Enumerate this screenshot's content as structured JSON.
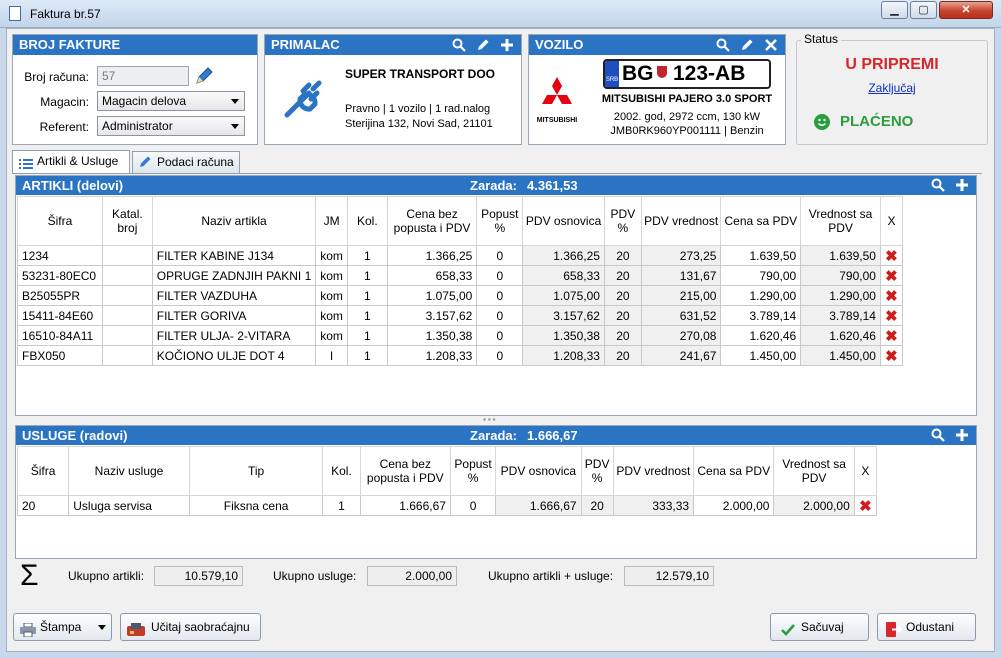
{
  "window": {
    "title": "Faktura br.57"
  },
  "broj_fakture": {
    "header": "BROJ FAKTURE",
    "broj_label": "Broj računa:",
    "broj_value": "57",
    "magacin_label": "Magacin:",
    "magacin_value": "Magacin delova",
    "referent_label": "Referent:",
    "referent_value": "Administrator"
  },
  "primalac": {
    "header": "PRIMALAC",
    "name": "SUPER TRANSPORT DOO",
    "info": "Pravno | 1 vozilo | 1 rad.nalog",
    "address": "Sterijina 132, Novi Sad, 21101"
  },
  "vozilo": {
    "header": "VOZILO",
    "plate_country": "SRB",
    "plate_city": "BG",
    "plate_number": "123-AB",
    "brand_label": "MITSUBISHI",
    "model": "MITSUBISHI PAJERO 3.0 SPORT",
    "specs": "2002. god, 2972 ccm, 130 kW",
    "vin": "JMB0RK960YP001111 | Benzin"
  },
  "status": {
    "label": "Status",
    "state": "U PRIPREMI",
    "lock_link": "Zaključaj",
    "paid": "PLAĆENO"
  },
  "tabs": [
    {
      "label": "Artikli & Usluge"
    },
    {
      "label": "Podaci računa"
    }
  ],
  "artikli": {
    "header": "ARTIKLI (delovi)",
    "zarada_label": "Zarada:",
    "zarada_value": "4.361,53",
    "columns": [
      "Šifra",
      "Katal. broj",
      "Naziv artikla",
      "JM",
      "Kol.",
      "Cena bez popusta i PDV",
      "Popust %",
      "PDV osnovica",
      "PDV %",
      "PDV vrednost",
      "Cena sa PDV",
      "Vrednost sa PDV",
      "X"
    ],
    "rows": [
      {
        "sifra": "1234",
        "katal": "",
        "naziv": "FILTER KABINE J134",
        "jm": "kom",
        "kol": "1",
        "cena": "1.366,25",
        "popust": "0",
        "osnovica": "1.366,25",
        "pdv": "20",
        "pdv_vr": "273,25",
        "cena_pdv": "1.639,50",
        "vrednost": "1.639,50"
      },
      {
        "sifra": "53231-80EC0",
        "katal": "",
        "naziv": "OPRUGE ZADNJIH PAKNI 1",
        "jm": "kom",
        "kol": "1",
        "cena": "658,33",
        "popust": "0",
        "osnovica": "658,33",
        "pdv": "20",
        "pdv_vr": "131,67",
        "cena_pdv": "790,00",
        "vrednost": "790,00"
      },
      {
        "sifra": "B25055PR",
        "katal": "",
        "naziv": "FILTER  VAZDUHA",
        "jm": "kom",
        "kol": "1",
        "cena": "1.075,00",
        "popust": "0",
        "osnovica": "1.075,00",
        "pdv": "20",
        "pdv_vr": "215,00",
        "cena_pdv": "1.290,00",
        "vrednost": "1.290,00"
      },
      {
        "sifra": "15411-84E60",
        "katal": "",
        "naziv": "FILTER GORIVA",
        "jm": "kom",
        "kol": "1",
        "cena": "3.157,62",
        "popust": "0",
        "osnovica": "3.157,62",
        "pdv": "20",
        "pdv_vr": "631,52",
        "cena_pdv": "3.789,14",
        "vrednost": "3.789,14"
      },
      {
        "sifra": "16510-84A11",
        "katal": "",
        "naziv": "FILTER ULJA- 2-VITARA",
        "jm": "kom",
        "kol": "1",
        "cena": "1.350,38",
        "popust": "0",
        "osnovica": "1.350,38",
        "pdv": "20",
        "pdv_vr": "270,08",
        "cena_pdv": "1.620,46",
        "vrednost": "1.620,46"
      },
      {
        "sifra": "FBX050",
        "katal": "",
        "naziv": "KOČIONO ULJE DOT 4",
        "jm": "l",
        "kol": "1",
        "cena": "1.208,33",
        "popust": "0",
        "osnovica": "1.208,33",
        "pdv": "20",
        "pdv_vr": "241,67",
        "cena_pdv": "1.450,00",
        "vrednost": "1.450,00"
      }
    ]
  },
  "usluge": {
    "header": "USLUGE (radovi)",
    "zarada_label": "Zarada:",
    "zarada_value": "1.666,67",
    "columns": [
      "Šifra",
      "Naziv usluge",
      "Tip",
      "Kol.",
      "Cena bez popusta i PDV",
      "Popust %",
      "PDV osnovica",
      "PDV %",
      "PDV vrednost",
      "Cena sa PDV",
      "Vrednost sa PDV",
      "X"
    ],
    "rows": [
      {
        "sifra": "20",
        "naziv": "Usluga servisa",
        "tip": "Fiksna cena",
        "kol": "1",
        "cena": "1.666,67",
        "popust": "0",
        "osnovica": "1.666,67",
        "pdv": "20",
        "pdv_vr": "333,33",
        "cena_pdv": "2.000,00",
        "vrednost": "2.000,00"
      }
    ]
  },
  "totals": {
    "sigma": "Σ",
    "artikli_label": "Ukupno artikli:",
    "artikli_value": "10.579,10",
    "usluge_label": "Ukupno usluge:",
    "usluge_value": "2.000,00",
    "ukupno_label": "Ukupno artikli + usluge:",
    "ukupno_value": "12.579,10"
  },
  "buttons": {
    "stampa": "Štampa",
    "ucitaj": "Učitaj saobraćajnu",
    "sacuvaj": "Sačuvaj",
    "odustani": "Odustani"
  },
  "colors": {
    "accent": "#2b74c4",
    "status_red": "#d8262a",
    "paid_green": "#2a9d3e"
  }
}
